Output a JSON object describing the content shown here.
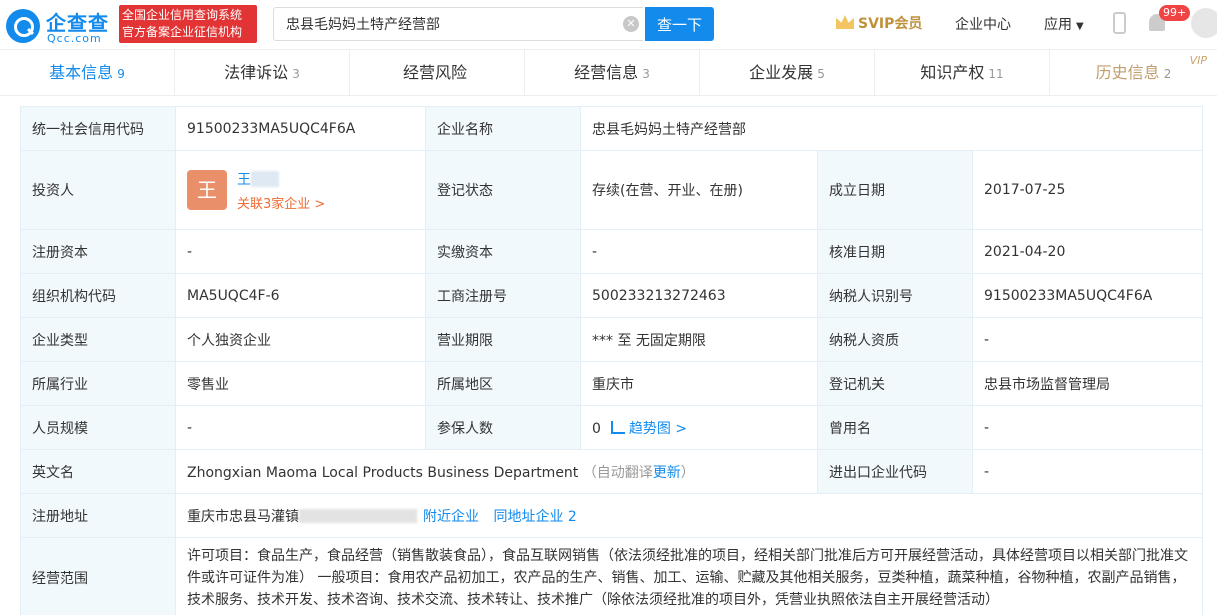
{
  "header": {
    "logo_cn": "企查查",
    "logo_en": "Qcc.com",
    "badge_line1": "全国企业信用查询系统",
    "badge_line2": "官方备案企业征信机构",
    "search_value": "忠县毛妈妈土特产经营部",
    "search_button": "查一下",
    "svip": "SVIP会员",
    "enterprise_center": "企业中心",
    "apps": "应用",
    "msg_count": "99+"
  },
  "tabs": [
    {
      "label": "基本信息",
      "count": "9"
    },
    {
      "label": "法律诉讼",
      "count": "3"
    },
    {
      "label": "经营风险",
      "count": ""
    },
    {
      "label": "经营信息",
      "count": "3"
    },
    {
      "label": "企业发展",
      "count": "5"
    },
    {
      "label": "知识产权",
      "count": "11"
    },
    {
      "label": "历史信息",
      "count": "2",
      "vip": "VIP"
    }
  ],
  "info": {
    "credit_code_label": "统一社会信用代码",
    "credit_code": "91500233MA5UQC4F6A",
    "company_name_label": "企业名称",
    "company_name": "忠县毛妈妈土特产经营部",
    "investor_label": "投资人",
    "investor_avatar": "王",
    "investor_name": "王",
    "investor_related": "关联3家企业 >",
    "status_label": "登记状态",
    "status": "存续(在营、开业、在册)",
    "founded_label": "成立日期",
    "founded": "2017-07-25",
    "reg_capital_label": "注册资本",
    "reg_capital": "-",
    "paid_capital_label": "实缴资本",
    "paid_capital": "-",
    "approved_label": "核准日期",
    "approved": "2021-04-20",
    "org_code_label": "组织机构代码",
    "org_code": "MA5UQC4F-6",
    "biz_reg_label": "工商注册号",
    "biz_reg": "500233213272463",
    "taxpayer_id_label": "纳税人识别号",
    "taxpayer_id": "91500233MA5UQC4F6A",
    "type_label": "企业类型",
    "type": "个人独资企业",
    "term_label": "营业期限",
    "term": "*** 至 无固定期限",
    "taxpayer_qual_label": "纳税人资质",
    "taxpayer_qual": "-",
    "industry_label": "所属行业",
    "industry": "零售业",
    "region_label": "所属地区",
    "region": "重庆市",
    "authority_label": "登记机关",
    "authority": "忠县市场监督管理局",
    "staff_label": "人员规模",
    "staff": "-",
    "insured_label": "参保人数",
    "insured": "0",
    "trend": "趋势图 >",
    "former_name_label": "曾用名",
    "former_name": "-",
    "en_name_label": "英文名",
    "en_name": "Zhongxian Maoma Local Products Business Department",
    "auto_translate": "（自动翻译",
    "update": "更新",
    "close_paren": "）",
    "import_export_label": "进出口企业代码",
    "import_export": "-",
    "address_label": "注册地址",
    "address": "重庆市忠县马灌镇",
    "nearby": "附近企业",
    "same_address": "同地址企业 2",
    "scope_label": "经营范围",
    "scope": "许可项目：食品生产，食品经营（销售散装食品），食品互联网销售（依法须经批准的项目，经相关部门批准后方可开展经营活动，具体经营项目以相关部门批准文件或许可证件为准） 一般项目：食用农产品初加工，农产品的生产、销售、加工、运输、贮藏及其他相关服务，豆类种植，蔬菜种植，谷物种植，农副产品销售，技术服务、技术开发、技术咨询、技术交流、技术转让、技术推广（除依法须经批准的项目外，凭营业执照依法自主开展经营活动）"
  },
  "colors": {
    "brand": "#128bed",
    "label_bg": "#f2f9fc",
    "badge_red": "#e23434",
    "related_orange": "#ee6c34"
  }
}
